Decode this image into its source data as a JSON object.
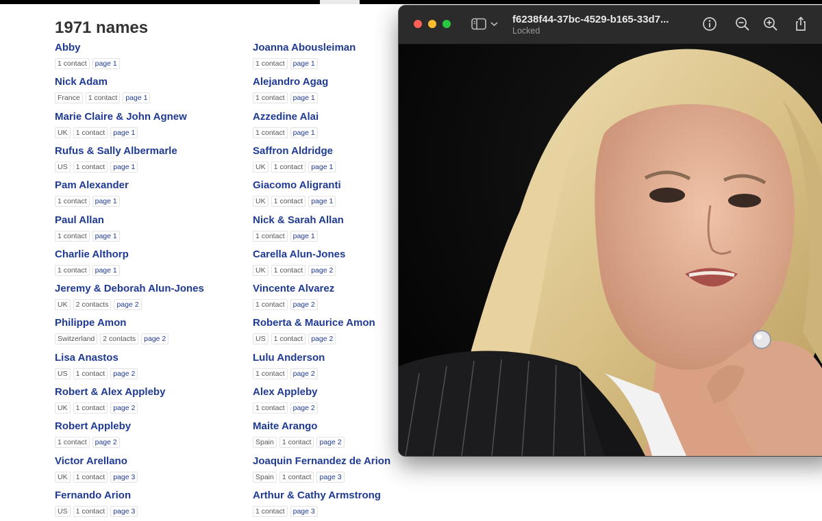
{
  "page": {
    "heading": "1971 names",
    "colors": {
      "link": "#1f3a93",
      "tag_border": "#e3e3e3",
      "heading": "#333333"
    }
  },
  "left_column": [
    {
      "name": "Abby",
      "tags": [
        "1 contact",
        "page 1"
      ]
    },
    {
      "name": "Nick Adam",
      "tags": [
        "France",
        "1 contact",
        "page 1"
      ]
    },
    {
      "name": "Marie Claire & John Agnew",
      "tags": [
        "UK",
        "1 contact",
        "page 1"
      ]
    },
    {
      "name": "Rufus & Sally Albermarle",
      "tags": [
        "US",
        "1 contact",
        "page 1"
      ]
    },
    {
      "name": "Pam Alexander",
      "tags": [
        "1 contact",
        "page 1"
      ]
    },
    {
      "name": "Paul Allan",
      "tags": [
        "1 contact",
        "page 1"
      ]
    },
    {
      "name": "Charlie Althorp",
      "tags": [
        "1 contact",
        "page 1"
      ]
    },
    {
      "name": "Jeremy & Deborah Alun-Jones",
      "tags": [
        "UK",
        "2 contacts",
        "page 2"
      ]
    },
    {
      "name": "Philippe Amon",
      "tags": [
        "Switzerland",
        "2 contacts",
        "page 2"
      ]
    },
    {
      "name": "Lisa Anastos",
      "tags": [
        "US",
        "1 contact",
        "page 2"
      ]
    },
    {
      "name": "Robert & Alex Appleby",
      "tags": [
        "UK",
        "1 contact",
        "page 2"
      ]
    },
    {
      "name": "Robert Appleby",
      "tags": [
        "1 contact",
        "page 2"
      ]
    },
    {
      "name": "Victor Arellano",
      "tags": [
        "UK",
        "1 contact",
        "page 3"
      ]
    },
    {
      "name": "Fernando Arion",
      "tags": [
        "US",
        "1 contact",
        "page 3"
      ]
    }
  ],
  "right_column": [
    {
      "name": "Joanna Abousleiman",
      "tags": [
        "1 contact",
        "page 1"
      ]
    },
    {
      "name": "Alejandro Agag",
      "tags": [
        "1 contact",
        "page 1"
      ]
    },
    {
      "name": "Azzedine Alai",
      "tags": [
        "1 contact",
        "page 1"
      ]
    },
    {
      "name": "Saffron Aldridge",
      "tags": [
        "UK",
        "1 contact",
        "page 1"
      ]
    },
    {
      "name": "Giacomo Aligranti",
      "tags": [
        "UK",
        "1 contact",
        "page 1"
      ]
    },
    {
      "name": "Nick & Sarah Allan",
      "tags": [
        "1 contact",
        "page 1"
      ]
    },
    {
      "name": "Carella Alun-Jones",
      "tags": [
        "UK",
        "1 contact",
        "page 2"
      ]
    },
    {
      "name": "Vincente Alvarez",
      "tags": [
        "1 contact",
        "page 2"
      ]
    },
    {
      "name": "Roberta & Maurice Amon",
      "tags": [
        "US",
        "1 contact",
        "page 2"
      ]
    },
    {
      "name": "Lulu Anderson",
      "tags": [
        "1 contact",
        "page 2"
      ]
    },
    {
      "name": "Alex Appleby",
      "tags": [
        "1 contact",
        "page 2"
      ]
    },
    {
      "name": "Maite Arango",
      "tags": [
        "Spain",
        "1 contact",
        "page 2"
      ]
    },
    {
      "name": "Joaquin Fernandez de Arion",
      "tags": [
        "Spain",
        "1 contact",
        "page 3"
      ]
    },
    {
      "name": "Arthur & Cathy Armstrong",
      "tags": [
        "1 contact",
        "page 3"
      ]
    }
  ],
  "preview_window": {
    "title": "f6238f44-37bc-4529-b165-33d7...",
    "subtitle": "Locked",
    "icons": [
      "sidebar-icon",
      "chevron-down-icon",
      "info-icon",
      "zoom-out-icon",
      "zoom-in-icon",
      "share-icon"
    ],
    "traffic_light_colors": {
      "close": "#ff5f57",
      "minimize": "#febc2e",
      "maximize": "#28c840"
    }
  }
}
